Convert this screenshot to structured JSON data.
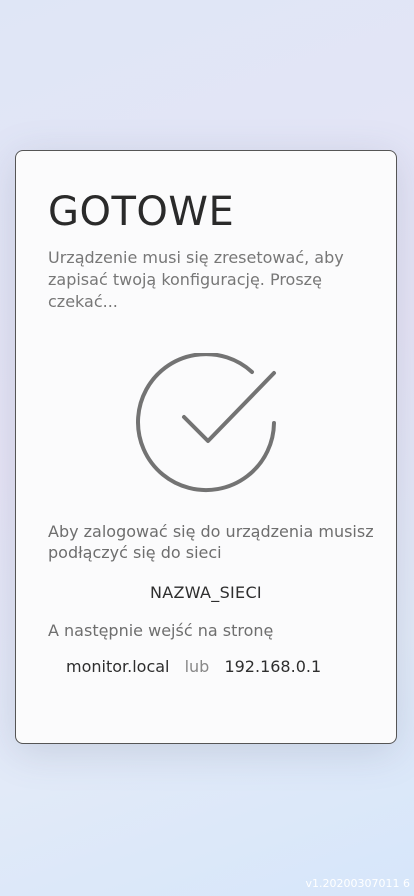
{
  "dialog": {
    "title": "GOTOWE",
    "message": "Urządzenie musi się zresetować, aby zapisać twoją konfigurację. Proszę czekać...",
    "status_icon": "check-circle-icon",
    "login_info": "Aby zalogować się do urządzenia musisz podłączyć się do sieci",
    "network_name": "NAZWA_SIECI",
    "then_visit": "A następnie wejść na stronę",
    "address_hostname": "monitor.local",
    "address_separator": "lub",
    "address_ip": "192.168.0.1"
  },
  "footer": {
    "version": "v1.20200307011 6"
  },
  "colors": {
    "card_background": "#fbfbfc",
    "card_border": "#555555",
    "icon_stroke": "#737373",
    "text_primary": "#2e2e2e",
    "text_secondary": "#6e6e6e"
  }
}
